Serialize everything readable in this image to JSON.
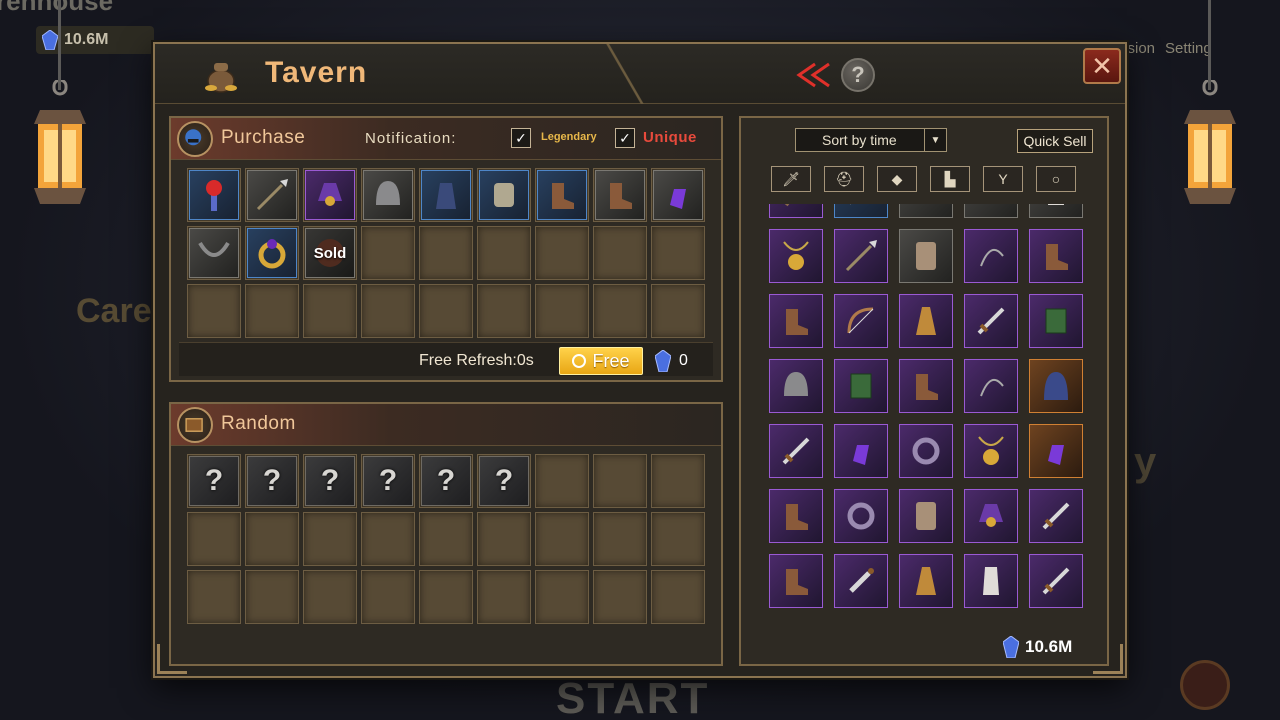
{
  "background": {
    "title": "renhouse",
    "gold": "10.6M",
    "topbar": [
      "ssion",
      "Setting"
    ],
    "left_text": "Care",
    "right_text": "y",
    "start_label": "START"
  },
  "window": {
    "title": "Tavern",
    "help_label": "?",
    "close_label": "✕"
  },
  "purchase": {
    "title": "Purchase",
    "notification_label": "Notification:",
    "legendary_label": "Legendary",
    "legendary_checked": true,
    "unique_label": "Unique",
    "unique_checked": true,
    "items": [
      {
        "icon": "torch-icon",
        "rarity": "blue"
      },
      {
        "icon": "spear-icon",
        "rarity": "gray"
      },
      {
        "icon": "wizard-hat-icon",
        "rarity": "purple"
      },
      {
        "icon": "knight-helmet-icon",
        "rarity": "gray"
      },
      {
        "icon": "hooded-cloak-icon",
        "rarity": "blue"
      },
      {
        "icon": "chest-armor-icon",
        "rarity": "blue"
      },
      {
        "icon": "fur-boots-icon",
        "rarity": "blue"
      },
      {
        "icon": "red-boots-icon",
        "rarity": "gray"
      },
      {
        "icon": "purple-amulet-icon",
        "rarity": "gray"
      },
      {
        "icon": "stone-necklace-icon",
        "rarity": "gray"
      },
      {
        "icon": "gold-ring-icon",
        "rarity": "blue"
      },
      {
        "icon": "sold-item-icon",
        "rarity": "gray",
        "label": "Sold"
      }
    ],
    "free_refresh_label": "Free Refresh:0s",
    "free_button_label": "Free",
    "gem_count": "0"
  },
  "random": {
    "title": "Random",
    "mystery_items": [
      "?",
      "?",
      "?",
      "?",
      "?",
      "?"
    ]
  },
  "inventory": {
    "sort_label": "Sort by time",
    "quick_sell_label": "Quick Sell",
    "filters": [
      "sword-filter-icon",
      "helmet-filter-icon",
      "armor-filter-icon",
      "boots-filter-icon",
      "necklace-filter-icon",
      "ring-filter-icon"
    ],
    "gold": "10.6M",
    "items": [
      {
        "icon": "staff-icon",
        "rarity": "purple"
      },
      {
        "icon": "sword-icon",
        "rarity": "blue"
      },
      {
        "icon": "bow-icon",
        "rarity": "gray"
      },
      {
        "icon": "whip-icon",
        "rarity": "gray"
      },
      {
        "icon": "robe-icon",
        "rarity": "gray"
      },
      {
        "icon": "gold-amulet-icon",
        "rarity": "purple"
      },
      {
        "icon": "spear-icon",
        "rarity": "purple"
      },
      {
        "icon": "chainmail-icon",
        "rarity": "gray"
      },
      {
        "icon": "whip-icon",
        "rarity": "purple"
      },
      {
        "icon": "leather-boots-icon",
        "rarity": "purple"
      },
      {
        "icon": "leather-boots-icon",
        "rarity": "purple"
      },
      {
        "icon": "bow-icon",
        "rarity": "purple"
      },
      {
        "icon": "cape-icon",
        "rarity": "purple"
      },
      {
        "icon": "sword-icon",
        "rarity": "purple"
      },
      {
        "icon": "green-book-icon",
        "rarity": "purple"
      },
      {
        "icon": "green-helmet-icon",
        "rarity": "purple"
      },
      {
        "icon": "green-book-icon",
        "rarity": "purple"
      },
      {
        "icon": "iron-boots-icon",
        "rarity": "purple"
      },
      {
        "icon": "whip-icon",
        "rarity": "purple"
      },
      {
        "icon": "blue-hood-icon",
        "rarity": "orange"
      },
      {
        "icon": "sword-icon",
        "rarity": "purple"
      },
      {
        "icon": "purple-amulet-icon",
        "rarity": "purple"
      },
      {
        "icon": "purple-ring-icon",
        "rarity": "purple"
      },
      {
        "icon": "gold-amulet-icon",
        "rarity": "purple"
      },
      {
        "icon": "purple-amulet-icon",
        "rarity": "orange"
      },
      {
        "icon": "iron-boots-icon",
        "rarity": "purple"
      },
      {
        "icon": "purple-ring-icon",
        "rarity": "purple"
      },
      {
        "icon": "chainmail-icon",
        "rarity": "purple"
      },
      {
        "icon": "wizard-hat-icon",
        "rarity": "purple"
      },
      {
        "icon": "sword-icon",
        "rarity": "purple"
      },
      {
        "icon": "leather-boots-icon",
        "rarity": "purple"
      },
      {
        "icon": "dagger-icon",
        "rarity": "purple"
      },
      {
        "icon": "cape-icon",
        "rarity": "purple"
      },
      {
        "icon": "robe-icon",
        "rarity": "purple"
      },
      {
        "icon": "sword-icon",
        "rarity": "purple"
      }
    ]
  },
  "colors": {
    "accent_gold": "#f0b879",
    "unique_red": "#e84a3c",
    "legendary_gold": "#e7b74a",
    "free_button": "#ffd24a",
    "rarity_purple": "#9a5ad3",
    "rarity_blue": "#4e86c8",
    "rarity_orange": "#d08033"
  }
}
